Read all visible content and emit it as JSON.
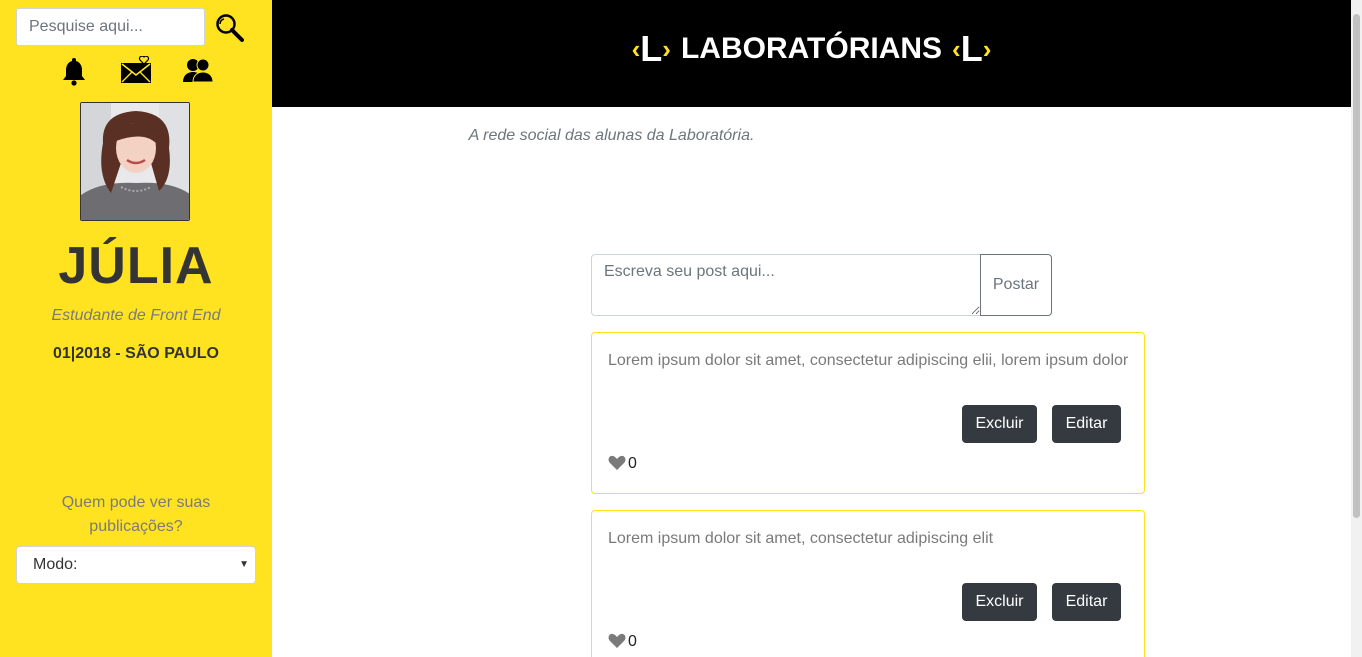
{
  "sidebar": {
    "search": {
      "placeholder": "Pesquise aqui..."
    },
    "icons": [
      "search-icon",
      "bell-icon",
      "mail-heart-icon",
      "users-icon"
    ],
    "user": {
      "name": "JÚLIA",
      "role": "Estudante de Front End",
      "info": "01|2018 - SÃO PAULO"
    },
    "privacy": {
      "label": "Quem pode ver suas publicações?",
      "selected": "Modo:"
    }
  },
  "header": {
    "title": "LABORATÓRIANS",
    "logo_letter": "L",
    "logo_left": "‹",
    "logo_right": "›",
    "tagline": "A rede social das alunas da Laboratória."
  },
  "composer": {
    "placeholder": "Escreva seu post aqui...",
    "post_label": "Postar"
  },
  "posts": [
    {
      "text": "Lorem ipsum dolor sit amet, consectetur adipiscing elii, lorem ipsum dolor",
      "delete_label": "Excluir",
      "edit_label": "Editar",
      "likes": "0"
    },
    {
      "text": "Lorem ipsum dolor sit amet, consectetur adipiscing elit",
      "delete_label": "Excluir",
      "edit_label": "Editar",
      "likes": "0"
    }
  ],
  "colors": {
    "accent": "#ffe320",
    "header_bg": "#000000",
    "button_dark": "#343a40"
  }
}
